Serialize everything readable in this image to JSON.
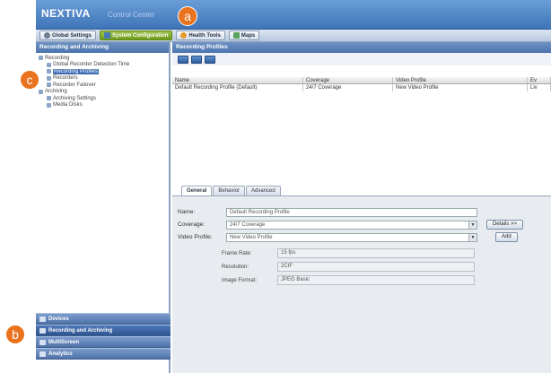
{
  "app": {
    "brand": "NEXTIVA",
    "product": "Control Center"
  },
  "toolbar": {
    "global_settings": "Global Settings",
    "system_config": "System Configuration",
    "health_tools": "Health Tools",
    "maps": "Maps"
  },
  "left": {
    "title": "Recording and Archiving",
    "tree": [
      {
        "label": "Recording",
        "level": 0,
        "selected": false
      },
      {
        "label": "Global Recorder Detection Time",
        "level": 1,
        "selected": false
      },
      {
        "label": "Recording Profiles",
        "level": 1,
        "selected": true
      },
      {
        "label": "Recorders",
        "level": 1,
        "selected": false
      },
      {
        "label": "Recorder Failover",
        "level": 1,
        "selected": false
      },
      {
        "label": "Archiving",
        "level": 0,
        "selected": false
      },
      {
        "label": "Archiving Settings",
        "level": 1,
        "selected": false
      },
      {
        "label": "Media Disks",
        "level": 1,
        "selected": false
      }
    ]
  },
  "nav": {
    "devices": "Devices",
    "recording": "Recording and Archiving",
    "multiscreen": "MultiScreen",
    "analytics": "Analytics"
  },
  "right": {
    "title": "Recording Profiles",
    "columns": [
      "Name",
      "Coverage",
      "Video Profile",
      "Ev"
    ],
    "rows": [
      [
        "Default Recording Profile (Default)",
        "24/7 Coverage",
        "New Video Profile",
        "Liv"
      ]
    ]
  },
  "tabs": [
    "General",
    "Behavior",
    "Advanced"
  ],
  "form": {
    "name_label": "Name:",
    "name_value": "Default Recording Profile",
    "coverage_label": "Coverage:",
    "coverage_value": "24/7 Coverage",
    "video_label": "Video Profile:",
    "video_value": "New Video Profile",
    "details_btn": "Details >>",
    "add_btn": "Add",
    "frame_rate_label": "Frame Rate:",
    "frame_rate_value": "15 fps",
    "resolution_label": "Resolution:",
    "resolution_value": "2CIF",
    "image_size_label": "Image Format:",
    "image_size_value": "JPEG Basic"
  },
  "markers": {
    "a": "a",
    "b": "b",
    "c": "c"
  }
}
